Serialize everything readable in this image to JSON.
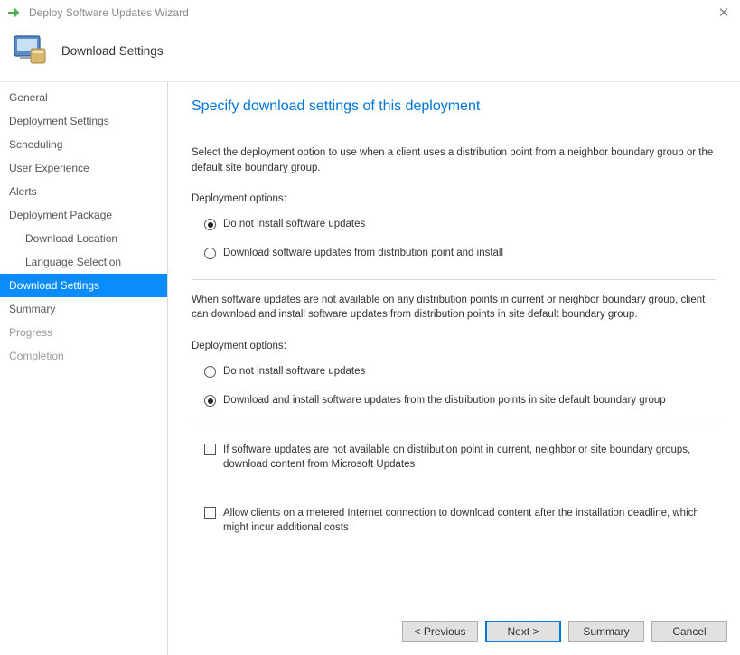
{
  "titlebar": {
    "title": "Deploy Software Updates Wizard"
  },
  "header": {
    "page_title": "Download Settings"
  },
  "sidebar": {
    "items": [
      {
        "label": "General",
        "child": false,
        "selected": false,
        "disabled": false
      },
      {
        "label": "Deployment Settings",
        "child": false,
        "selected": false,
        "disabled": false
      },
      {
        "label": "Scheduling",
        "child": false,
        "selected": false,
        "disabled": false
      },
      {
        "label": "User Experience",
        "child": false,
        "selected": false,
        "disabled": false
      },
      {
        "label": "Alerts",
        "child": false,
        "selected": false,
        "disabled": false
      },
      {
        "label": "Deployment Package",
        "child": false,
        "selected": false,
        "disabled": false
      },
      {
        "label": "Download Location",
        "child": true,
        "selected": false,
        "disabled": false
      },
      {
        "label": "Language Selection",
        "child": true,
        "selected": false,
        "disabled": false
      },
      {
        "label": "Download Settings",
        "child": false,
        "selected": true,
        "disabled": false
      },
      {
        "label": "Summary",
        "child": false,
        "selected": false,
        "disabled": false
      },
      {
        "label": "Progress",
        "child": false,
        "selected": false,
        "disabled": true
      },
      {
        "label": "Completion",
        "child": false,
        "selected": false,
        "disabled": true
      }
    ]
  },
  "main": {
    "heading": "Specify download settings of this deployment",
    "instruction1": "Select the deployment option to use when a client uses a distribution point from a neighbor boundary group or the default site boundary group.",
    "group1_label": "Deployment options:",
    "group1": {
      "opt1": "Do not install software updates",
      "opt2": "Download software updates from distribution point and install"
    },
    "instruction2": "When software updates are not available on any distribution points in current or neighbor boundary group, client can download and install software updates from distribution points in site default boundary group.",
    "group2_label": "Deployment options:",
    "group2": {
      "opt1": "Do not install software updates",
      "opt2": "Download and install software updates from the distribution points in site default boundary group"
    },
    "check1": "If software updates are not available on distribution point in current, neighbor or site boundary groups, download content from Microsoft Updates",
    "check2": "Allow clients on a metered Internet connection to download content after the installation deadline, which might incur additional costs"
  },
  "footer": {
    "previous": "<  Previous",
    "next": "Next  >",
    "summary": "Summary",
    "cancel": "Cancel"
  }
}
